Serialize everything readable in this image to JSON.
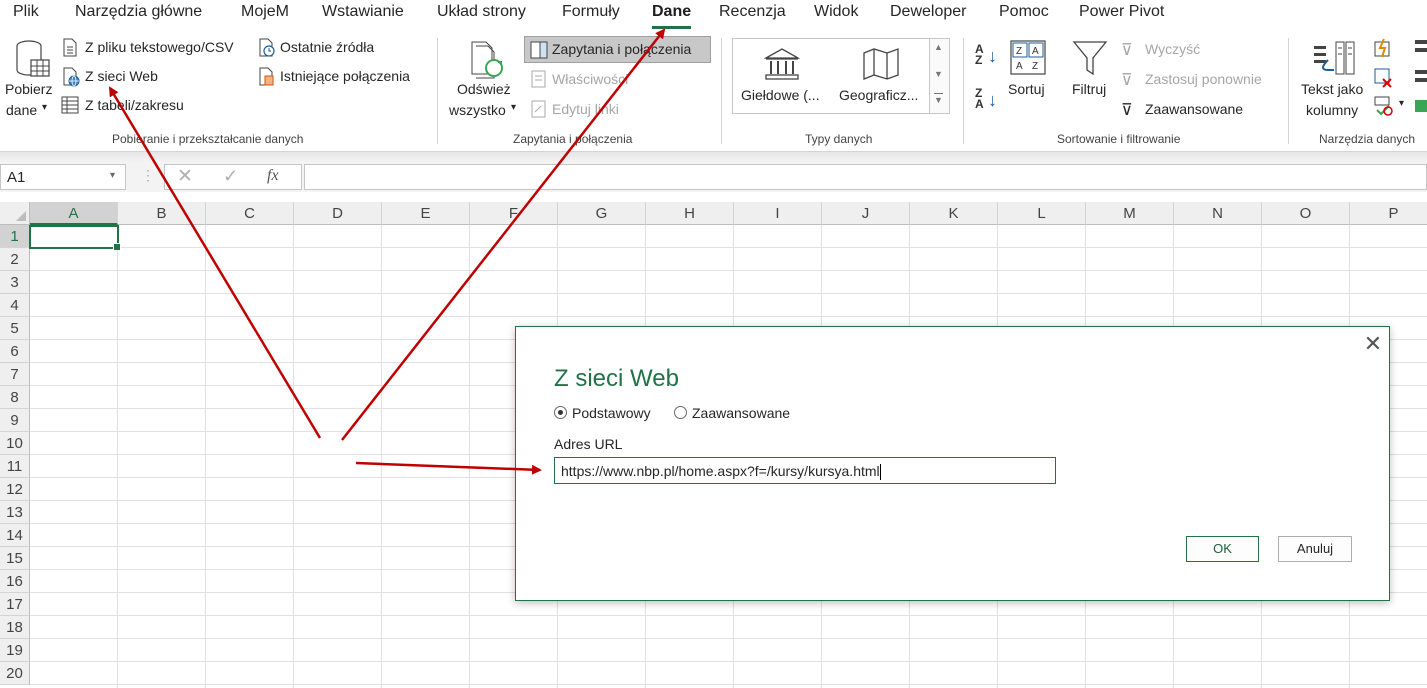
{
  "tabs": [
    "Plik",
    "Narzędzia główne",
    "MojeM",
    "Wstawianie",
    "Układ strony",
    "Formuły",
    "Dane",
    "Recenzja",
    "Widok",
    "Deweloper",
    "Pomoc",
    "Power Pivot"
  ],
  "active_tab": "Dane",
  "ribbon": {
    "get_data": {
      "pobierz_line1": "Pobierz",
      "pobierz_line2": "dane",
      "from_text": "Z pliku tekstowego/CSV",
      "from_web": "Z sieci Web",
      "from_table": "Z tabeli/zakresu",
      "recent_sources": "Ostatnie źródła",
      "existing_connections": "Istniejące połączenia",
      "group_label": "Pobieranie i przekształcanie danych"
    },
    "queries": {
      "refresh_line1": "Odśwież",
      "refresh_line2": "wszystko",
      "queries_connections": "Zapytania i połączenia",
      "properties": "Właściwości",
      "edit_links": "Edytuj linki",
      "group_label": "Zapytania i połączenia"
    },
    "data_types": {
      "stocks": "Giełdowe (...",
      "geography": "Geograficz...",
      "group_label": "Typy danych"
    },
    "sort_filter": {
      "sort": "Sortuj",
      "filter": "Filtruj",
      "clear": "Wyczyść",
      "reapply": "Zastosuj ponownie",
      "advanced": "Zaawansowane",
      "group_label": "Sortowanie i filtrowanie"
    },
    "data_tools": {
      "text_to_columns_line1": "Tekst jako",
      "text_to_columns_line2": "kolumny",
      "group_label": "Narzędzia danych"
    }
  },
  "formula_bar": {
    "name_box": "A1",
    "fx_symbol": "fx",
    "formula": ""
  },
  "grid": {
    "columns": [
      "A",
      "B",
      "C",
      "D",
      "E",
      "F",
      "G",
      "H",
      "I",
      "J",
      "K",
      "L",
      "M",
      "N",
      "O",
      "P"
    ],
    "rows": [
      "1",
      "2",
      "3",
      "4",
      "5",
      "6",
      "7",
      "8",
      "9",
      "10",
      "11",
      "12",
      "13",
      "14",
      "15",
      "16",
      "17",
      "18",
      "19",
      "20"
    ]
  },
  "dialog": {
    "title": "Z sieci Web",
    "basic_label": "Podstawowy",
    "advanced_label": "Zaawansowane",
    "url_label": "Adres URL",
    "url_value": "https://www.nbp.pl/home.aspx?f=/kursy/kursya.html",
    "ok": "OK",
    "cancel": "Anuluj",
    "close_symbol": "✕"
  },
  "colors": {
    "accent": "#217346",
    "arrow": "#c00000"
  }
}
